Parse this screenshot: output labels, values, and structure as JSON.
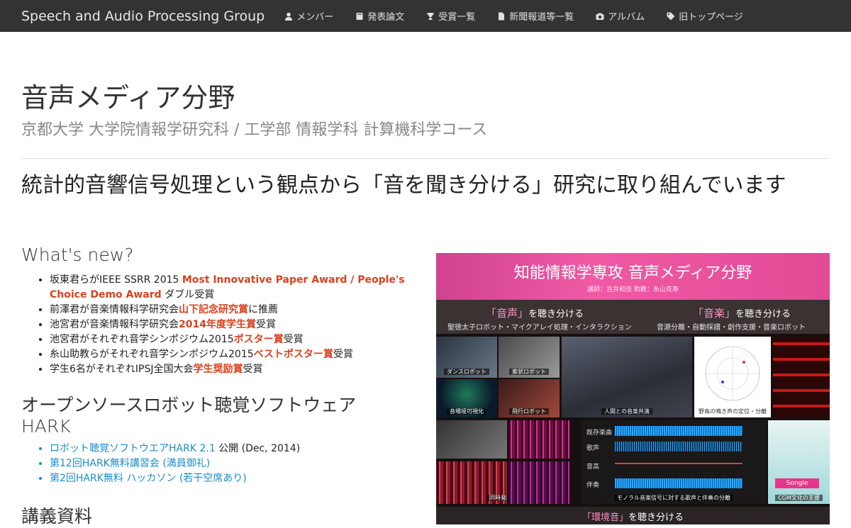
{
  "nav": {
    "brand": "Speech and Audio Processing Group",
    "items": [
      {
        "label": "メンバー",
        "icon": "user-icon"
      },
      {
        "label": "発表論文",
        "icon": "book-icon"
      },
      {
        "label": "受賞一覧",
        "icon": "trophy-icon"
      },
      {
        "label": "新聞報道等一覧",
        "icon": "file-icon"
      },
      {
        "label": "アルバム",
        "icon": "camera-icon"
      },
      {
        "label": "旧トップページ",
        "icon": "tag-icon"
      }
    ]
  },
  "header": {
    "title": "音声メディア分野",
    "subtitle": "京都大学 大学院情報学研究科 / 工学部 情報学科 計算機科学コース"
  },
  "tagline": "統計的音響信号処理という観点から「音を聞き分ける」研究に取り組んでいます",
  "whats_new": {
    "heading": "What's new?",
    "items": [
      {
        "pre": "坂東君らがIEEE SSRR 2015 ",
        "hl": "Most Innovative Paper Award / People's Choice Demo Award",
        "post": " ダブル受賞"
      },
      {
        "pre": "前澤君が音楽情報科学研究会",
        "hl": "山下記念研究賞",
        "post": "に推薦"
      },
      {
        "pre": "池宮君が音楽情報科学研究会",
        "hl": "2014年度学生賞",
        "post": "受賞"
      },
      {
        "pre": "池宮君がそれぞれ音学シンポジウム2015",
        "hl": "ポスター賞",
        "post": "受賞"
      },
      {
        "pre": "糸山助教らがそれぞれ音学シンポジウム2015",
        "hl": "ベストポスター賞",
        "post": "受賞"
      },
      {
        "pre": "学生6名がそれぞれIPSJ全国大会",
        "hl": "学生奨励賞",
        "post": "受賞"
      }
    ]
  },
  "hark": {
    "heading": "オープンソースロボット聴覚ソフトウェア",
    "heading2": "HARK",
    "items": [
      {
        "link": "ロボット聴覚ソフトウエアHARK 2.1",
        "post": " 公開 (Dec, 2014)"
      },
      {
        "link": "第12回HARK無料講習会 (満員御礼)",
        "post": ""
      },
      {
        "link": "第2回HARK無料 ハッカソン (若干空席あり)",
        "post": ""
      }
    ]
  },
  "lecture": {
    "heading": "講義資料"
  },
  "poster": {
    "title": "知能情報学専攻 音声メディア分野",
    "staff": "講師：吉井和佳 助教：糸山克寿",
    "left_heading_q": "「音声」",
    "left_heading_rest": "を聴き分ける",
    "left_sub": "聖徳太子ロボット・マイクアレイ処理・インタラクション",
    "right_heading_q": "「音楽」",
    "right_heading_rest": "を聴き分ける",
    "right_sub": "音源分離・自動採譜・創作支援・音楽ロボット",
    "captions": [
      "ダンスロボット",
      "索状ロボット",
      "音場境可視化",
      "飛行ロボット",
      "人間との音楽共演",
      "野鳥の鳴き声の定位・分離",
      "同時発話の分離・認識",
      "モノラル音楽信号に対する歌声と伴奏の分離",
      "CGM文化の支援"
    ],
    "wave_labels": [
      "既存楽曲",
      "歌声",
      "音高",
      "伴奏"
    ],
    "songle": "Songle",
    "bottom_q": "「環境音」",
    "bottom_rest": "を聴き分ける"
  }
}
